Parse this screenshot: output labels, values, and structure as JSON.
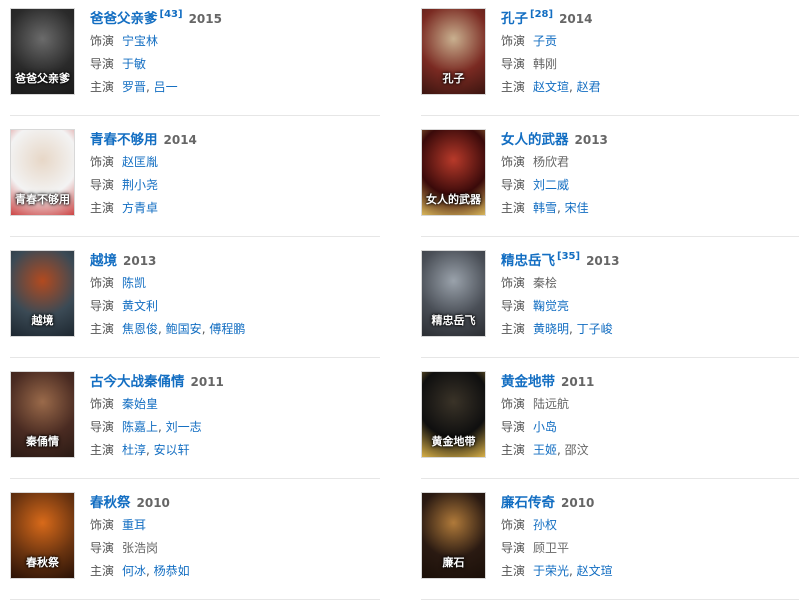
{
  "films": [
    {
      "title": "爸爸父亲爹",
      "ref": "[43]",
      "year": "2015",
      "poster_text": "爸爸父亲爹",
      "poster_colors": [
        "#2a2a2a",
        "#6b6b6b",
        "#1a1a1a"
      ],
      "role_label": "饰演",
      "role": "宁宝林",
      "role_link": true,
      "director_label": "导演",
      "directors": [
        "于敏"
      ],
      "cast_label": "主演",
      "cast": [
        "罗晋",
        "吕一"
      ]
    },
    {
      "title": "孔子",
      "ref": "[28]",
      "year": "2014",
      "poster_text": "孔子",
      "poster_colors": [
        "#7a2a22",
        "#c9b08f",
        "#3b1510"
      ],
      "role_label": "饰演",
      "role": "子贡",
      "role_link": true,
      "director_label": "导演",
      "directors": [
        "韩刚"
      ],
      "directors_link": false,
      "cast_label": "主演",
      "cast": [
        "赵文瑄",
        "赵君"
      ]
    },
    {
      "title": "青春不够用",
      "ref": "",
      "year": "2014",
      "poster_text": "青春不够用",
      "poster_colors": [
        "#f3f3f3",
        "#e7d7c7",
        "#c44"
      ],
      "role_label": "饰演",
      "role": "赵匡胤",
      "role_link": true,
      "director_label": "导演",
      "directors": [
        "荆小尧"
      ],
      "cast_label": "主演",
      "cast": [
        "方青卓"
      ]
    },
    {
      "title": "女人的武器",
      "ref": "",
      "year": "2013",
      "poster_text": "女人的武器",
      "poster_colors": [
        "#3a0a0a",
        "#b83a2a",
        "#d8b65a"
      ],
      "role_label": "饰演",
      "role": "杨欣君",
      "role_link": false,
      "director_label": "导演",
      "directors": [
        "刘二威"
      ],
      "cast_label": "主演",
      "cast": [
        "韩雪",
        "宋佳"
      ]
    },
    {
      "title": "越境",
      "ref": "",
      "year": "2013",
      "poster_text": "越境",
      "poster_colors": [
        "#3b4a55",
        "#b24a1f",
        "#1d2730"
      ],
      "role_label": "饰演",
      "role": "陈凯",
      "role_link": true,
      "director_label": "导演",
      "directors": [
        "黄文利"
      ],
      "cast_label": "主演",
      "cast": [
        "焦恩俊",
        "鲍国安",
        "傅程鹏"
      ]
    },
    {
      "title": "精忠岳飞",
      "ref": "[35]",
      "year": "2013",
      "poster_text": "精忠岳飞",
      "poster_colors": [
        "#4a4f57",
        "#9aa2ab",
        "#2b2e33"
      ],
      "role_label": "饰演",
      "role": "秦桧",
      "role_link": false,
      "director_label": "导演",
      "directors": [
        "鞠觉亮"
      ],
      "cast_label": "主演",
      "cast": [
        "黄晓明",
        "丁子峻"
      ]
    },
    {
      "title": "古今大战秦俑情",
      "ref": "",
      "year": "2011",
      "poster_text": "秦俑情",
      "poster_colors": [
        "#4a2b22",
        "#9a6a4a",
        "#2a1a14"
      ],
      "role_label": "饰演",
      "role": "秦始皇",
      "role_link": true,
      "director_label": "导演",
      "directors": [
        "陈嘉上",
        "刘一志"
      ],
      "cast_label": "主演",
      "cast": [
        "杜淳",
        "安以轩"
      ]
    },
    {
      "title": "黄金地带",
      "ref": "",
      "year": "2011",
      "poster_text": "黄金地带",
      "poster_colors": [
        "#0f0f0f",
        "#3a3328",
        "#d8b047"
      ],
      "role_label": "饰演",
      "role": "陆远航",
      "role_link": false,
      "director_label": "导演",
      "directors": [
        "小岛"
      ],
      "cast_label": "主演",
      "cast": [
        "王姬",
        "邵汶"
      ],
      "cast_last_plain": true
    },
    {
      "title": "春秋祭",
      "ref": "",
      "year": "2010",
      "poster_text": "春秋祭",
      "poster_colors": [
        "#6b3410",
        "#d86a1a",
        "#2a1206"
      ],
      "role_label": "饰演",
      "role": "重耳",
      "role_link": true,
      "director_label": "导演",
      "directors": [
        "张浩岗"
      ],
      "directors_link": false,
      "cast_label": "主演",
      "cast": [
        "何冰",
        "杨恭如"
      ]
    },
    {
      "title": "廉石传奇",
      "ref": "",
      "year": "2010",
      "poster_text": "廉石",
      "poster_colors": [
        "#2a1a12",
        "#b07a3a",
        "#1a0f08"
      ],
      "role_label": "饰演",
      "role": "孙权",
      "role_link": true,
      "director_label": "导演",
      "directors": [
        "顾卫平"
      ],
      "directors_link": false,
      "cast_label": "主演",
      "cast": [
        "于荣光",
        "赵文瑄"
      ]
    }
  ]
}
